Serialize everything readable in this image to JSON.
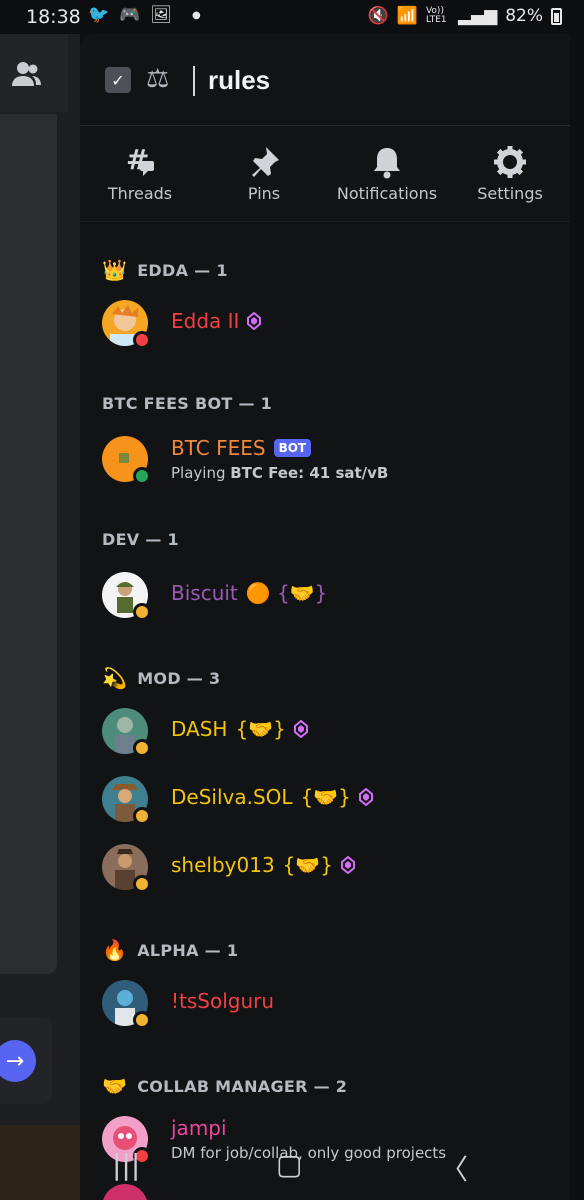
{
  "status_bar": {
    "time": "18:38",
    "battery": "82%",
    "left_icons": [
      "twitter-icon",
      "discord-icon",
      "gallery-icon",
      "dot-icon"
    ],
    "right_icons": [
      "mute-icon",
      "wifi-icon",
      "lte-icon",
      "signal-icon",
      "battery-icon"
    ],
    "lte_label": "Vo)) LTE1"
  },
  "channel": {
    "title": "rules",
    "icons": [
      "rules-channel-icon",
      "scales-icon"
    ]
  },
  "toolbar": [
    {
      "label": "Threads",
      "icon": "threads-icon",
      "glyph": "#"
    },
    {
      "label": "Pins",
      "icon": "pin-icon",
      "glyph": "📌"
    },
    {
      "label": "Notifications",
      "icon": "bell-icon",
      "glyph": "🔔"
    },
    {
      "label": "Settings",
      "icon": "gear-icon",
      "glyph": "⚙"
    }
  ],
  "sections": [
    {
      "title": "EDDA — 1",
      "emoji": "👑",
      "members": [
        {
          "name": "Edda II",
          "color": "#f23f43",
          "status": "dnd",
          "badge": "boost",
          "avatar_color": "#f5a623"
        }
      ]
    },
    {
      "title": "BTC FEES BOT — 1",
      "emoji": "",
      "members": [
        {
          "name": "BTC FEES",
          "color": "#f0883e",
          "status": "online",
          "tag": "BOT",
          "subtitle_prefix": "Playing ",
          "subtitle": "BTC Fee: 41 sat/vB",
          "avatar_color": "#f7931a"
        }
      ]
    },
    {
      "title": "DEV — 1",
      "emoji": "",
      "members": [
        {
          "name": "Biscuit",
          "suffix": "🟠 {🤝}",
          "color": "#9b59b6",
          "status": "idle",
          "avatar_color": "#e8e8e8"
        }
      ]
    },
    {
      "title": "MOD — 3",
      "emoji": "💫",
      "members": [
        {
          "name": "DASH",
          "suffix": "{🤝}",
          "color": "#f1c40f",
          "status": "idle",
          "badge": "boost",
          "avatar_color": "#4d8b7a"
        },
        {
          "name": "DeSilva.SOL",
          "suffix": "{🤝}",
          "color": "#f1c40f",
          "status": "idle",
          "badge": "boost",
          "avatar_color": "#3f7f8f"
        },
        {
          "name": "shelby013",
          "suffix": "{🤝}",
          "color": "#f1c40f",
          "status": "idle",
          "badge": "boost",
          "avatar_color": "#8a6d5a"
        }
      ]
    },
    {
      "title": "ALPHA — 1",
      "emoji": "🔥",
      "members": [
        {
          "name": "!tsSolguru",
          "color": "#f23f43",
          "status": "idle",
          "avatar_color": "#2f5d7a"
        }
      ]
    },
    {
      "title": "COLLAB MANAGER — 2",
      "emoji": "🤝",
      "members": [
        {
          "name": "jampi",
          "color": "#eb459e",
          "status": "dnd",
          "subtitle": "DM for job/collab, only good projects",
          "avatar_color": "#e94e77"
        }
      ]
    }
  ],
  "nav_bar": {
    "recents": "|||",
    "home": "▢",
    "back": "〈"
  }
}
